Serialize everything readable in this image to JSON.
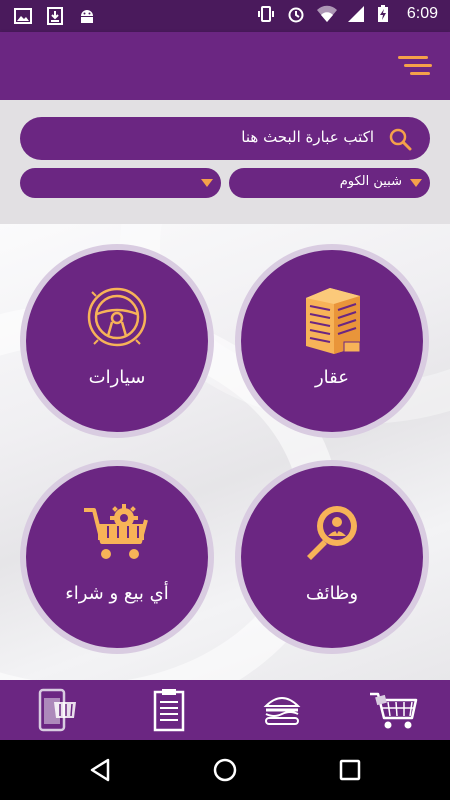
{
  "status_bar": {
    "time": "6:09",
    "left_icons": [
      "image-icon",
      "download-icon",
      "android-icon"
    ],
    "right_icons": [
      "vibrate-icon",
      "alarm-icon",
      "wifi-icon",
      "signal-icon",
      "battery-charging-icon"
    ]
  },
  "app_bar": {
    "menu_icon": "hamburger-menu-icon"
  },
  "search": {
    "placeholder": "اكتب عبارة البحث هنا",
    "icon": "search-icon"
  },
  "filters": {
    "city": {
      "selected": "شبين الكوم"
    },
    "category": {
      "selected": ""
    }
  },
  "categories": [
    {
      "label": "عقار",
      "icon": "building-icon"
    },
    {
      "label": "سيارات",
      "icon": "steering-wheel-icon"
    },
    {
      "label": "وظائف",
      "icon": "job-search-icon"
    },
    {
      "label": "أي بيع و شراء",
      "icon": "shopping-cart-gear-icon"
    }
  ],
  "bottom_nav": {
    "items": [
      {
        "icon": "shopping-cart-icon"
      },
      {
        "icon": "burger-icon"
      },
      {
        "icon": "clipboard-icon"
      },
      {
        "icon": "mobile-store-icon"
      }
    ]
  },
  "system_nav": {
    "buttons": [
      "back-icon",
      "home-icon",
      "recents-icon"
    ]
  },
  "colors": {
    "primary": "#6b2682",
    "status_bar": "#4a1a5c",
    "accent": "#f5a14a",
    "icon_fill": "#f7b358",
    "ring": "#d9cce1"
  }
}
